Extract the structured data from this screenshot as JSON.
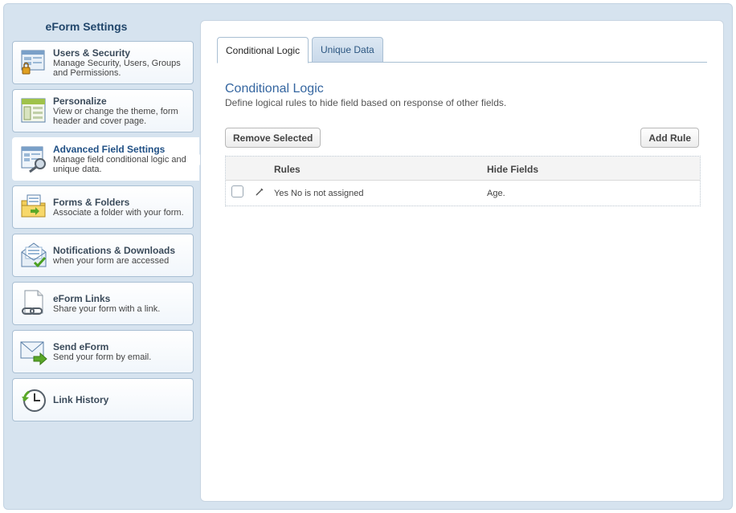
{
  "sidebar": {
    "title": "eForm Settings",
    "items": [
      {
        "title": "Users & Security",
        "desc": "Manage Security, Users, Groups and Permissions.",
        "icon": "users-security-icon"
      },
      {
        "title": "Personalize",
        "desc": "View or change the theme, form header and cover page.",
        "icon": "personalize-icon"
      },
      {
        "title": "Advanced Field Settings",
        "desc": "Manage field conditional logic and unique data.",
        "icon": "advanced-field-icon",
        "active": true
      },
      {
        "title": "Forms & Folders",
        "desc": "Associate a folder with your form.",
        "icon": "folder-icon"
      },
      {
        "title": "Notifications & Downloads",
        "desc": "when your form are accessed",
        "icon": "notification-icon"
      },
      {
        "title": "eForm Links",
        "desc": "Share your form with a link.",
        "icon": "link-icon"
      },
      {
        "title": "Send eForm",
        "desc": "Send your form by email.",
        "icon": "send-email-icon"
      },
      {
        "title": "Link History",
        "desc": "",
        "icon": "history-clock-icon"
      }
    ]
  },
  "tabs": [
    {
      "label": "Conditional Logic",
      "active": true
    },
    {
      "label": "Unique Data",
      "active": false
    }
  ],
  "main": {
    "title": "Conditional Logic",
    "description": "Define logical rules to hide field based on response of other fields.",
    "remove_button": "Remove Selected",
    "add_button": "Add Rule",
    "table": {
      "headers": {
        "rules": "Rules",
        "hide_fields": "Hide Fields"
      },
      "rows": [
        {
          "rule": "Yes No is not assigned",
          "hide_fields": "Age."
        }
      ]
    }
  },
  "colors": {
    "accent": "#3566a0",
    "sidebar_bg": "#d6e3ef"
  }
}
